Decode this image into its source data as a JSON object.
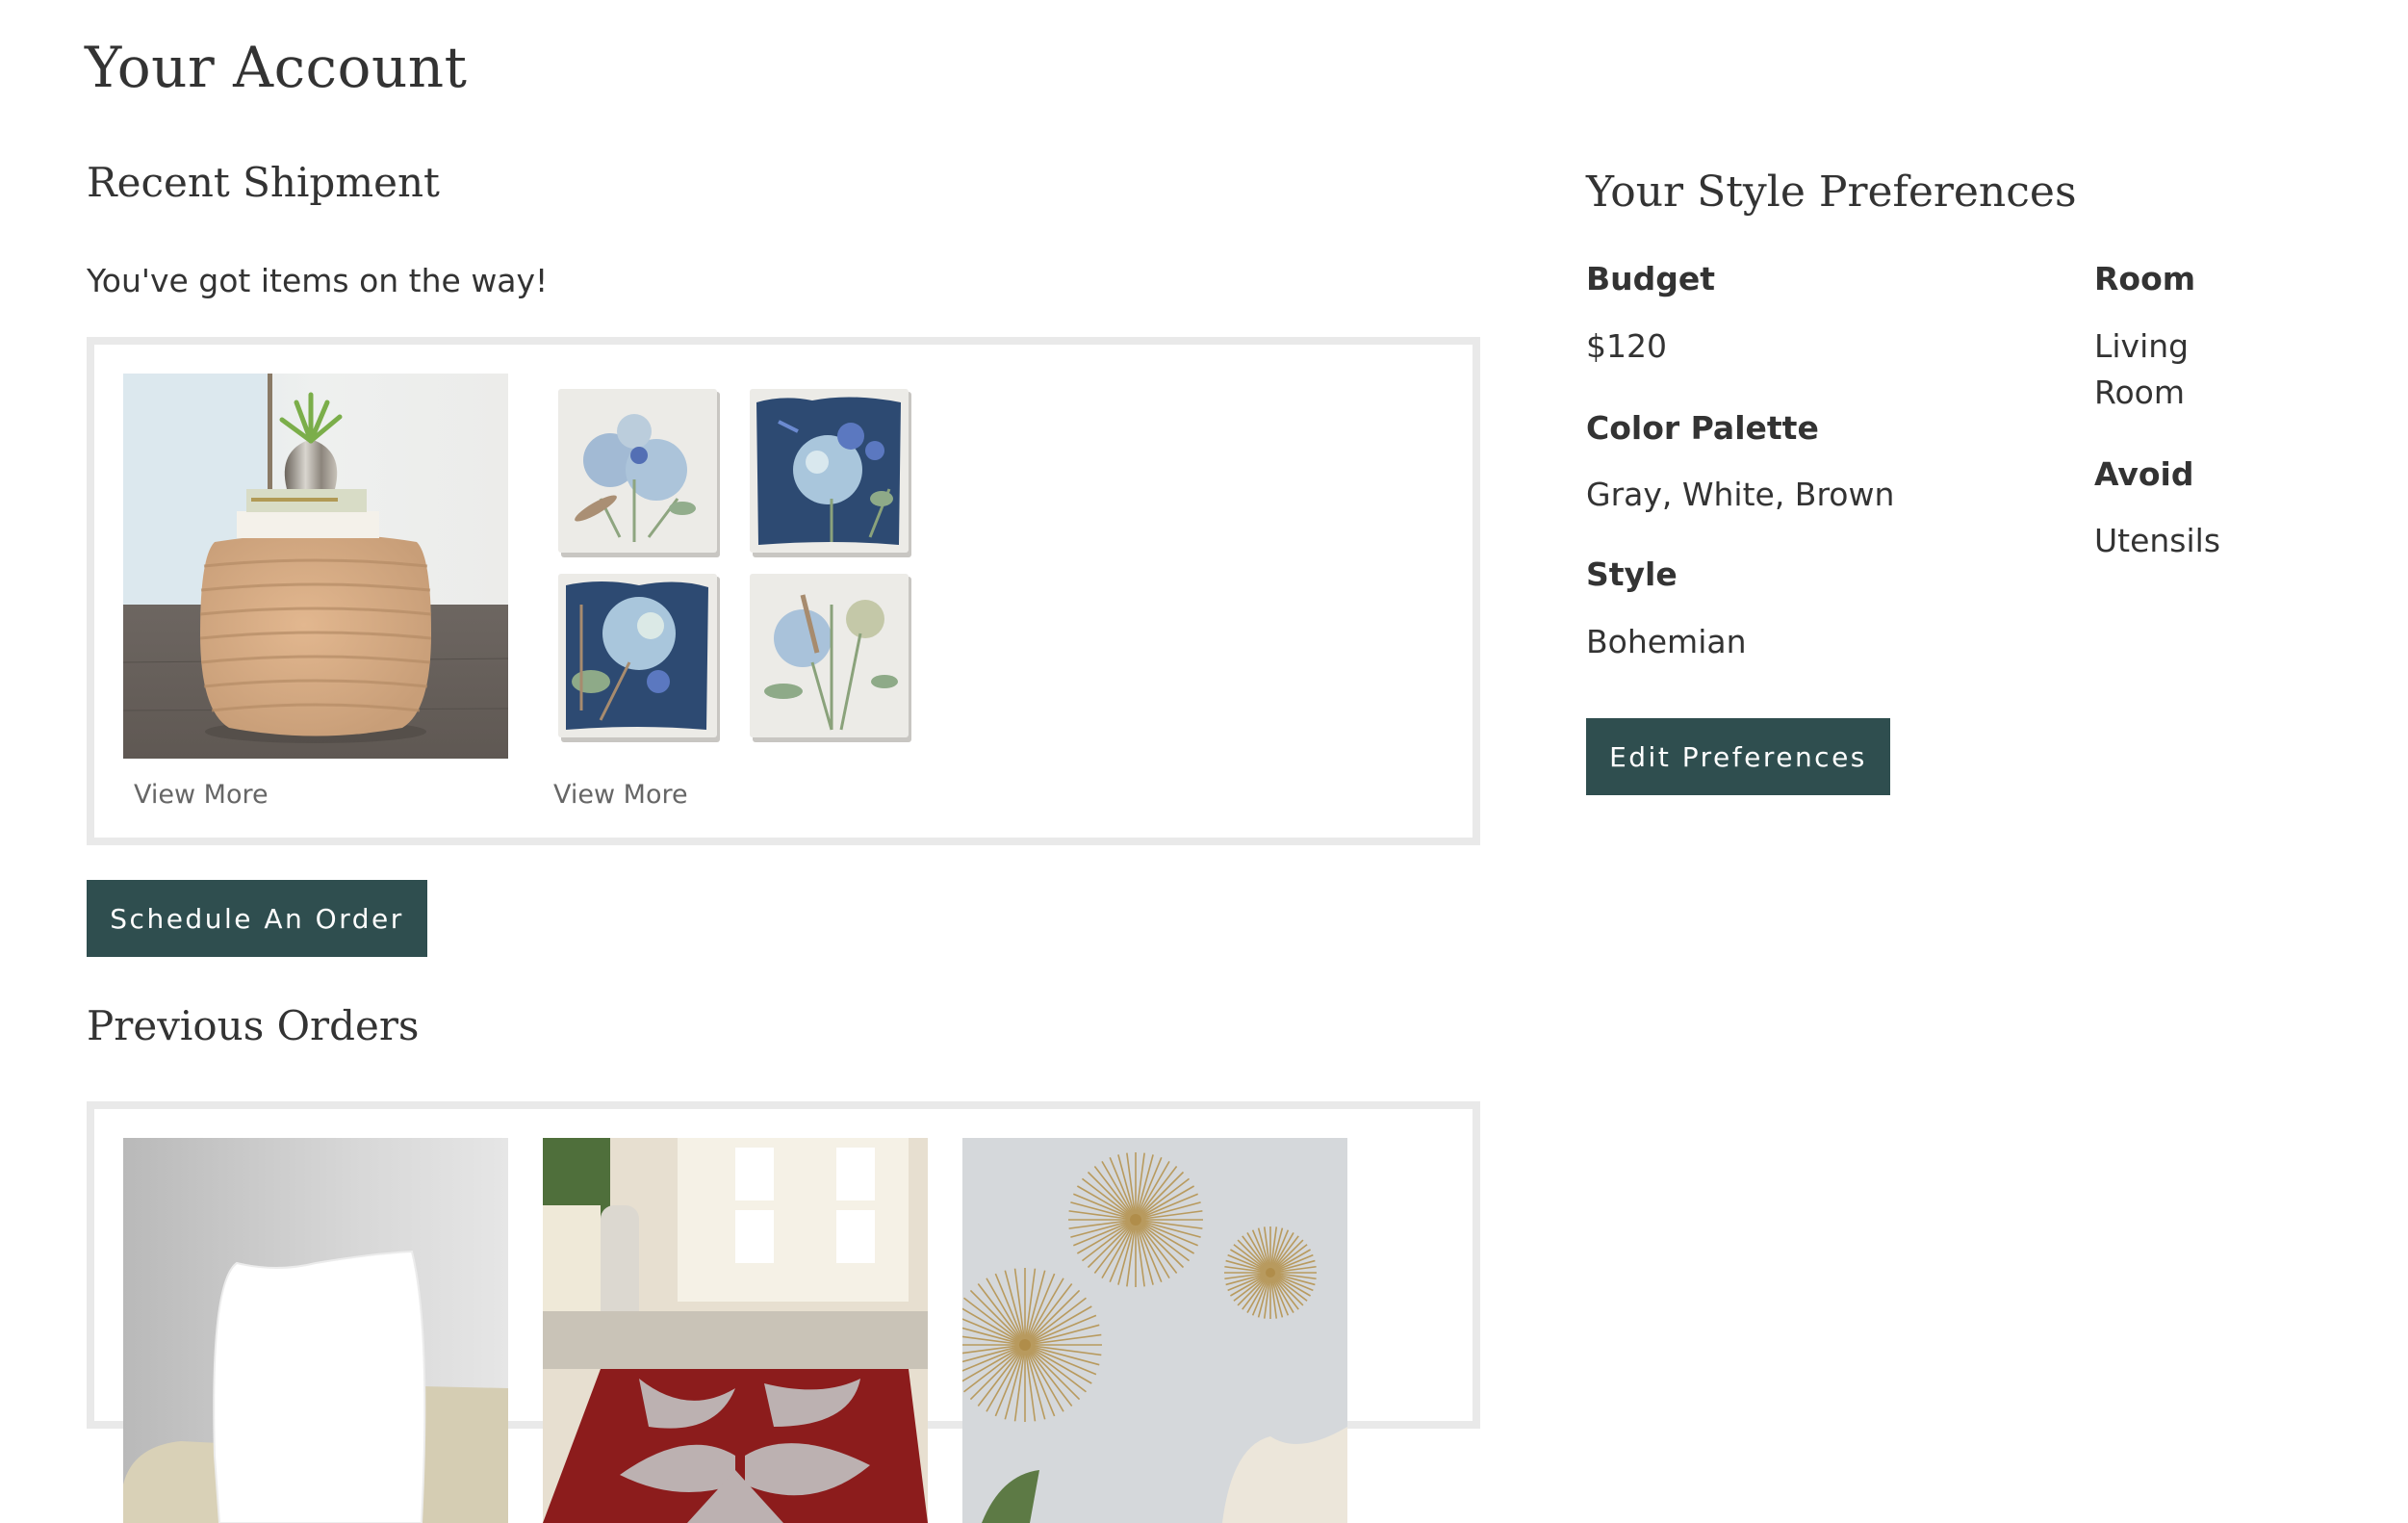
{
  "page": {
    "title": "Your Account"
  },
  "recent_shipment": {
    "heading": "Recent Shipment",
    "status": "You've got items on the way!",
    "items": [
      {
        "name": "Braided jute pouf",
        "image": "pouf-photo",
        "link_label": "View More"
      },
      {
        "name": "Blue hydrangea coaster set",
        "image": "floral-tiles-photo",
        "link_label": "View More"
      }
    ],
    "schedule_button": "Schedule An Order"
  },
  "previous_orders": {
    "heading": "Previous Orders",
    "items": [
      {
        "name": "White pillow insert",
        "image": "pillow-photo"
      },
      {
        "name": "Red and gray floral rug",
        "image": "rug-photo"
      },
      {
        "name": "Gold starburst wall decor",
        "image": "starburst-photo"
      }
    ]
  },
  "style_preferences": {
    "heading": "Your Style Preferences",
    "fields": {
      "budget": {
        "label": "Budget",
        "value": "$120"
      },
      "color_palette": {
        "label": "Color Palette",
        "value": "Gray, White, Brown"
      },
      "style": {
        "label": "Style",
        "value": "Bohemian"
      },
      "room": {
        "label": "Room",
        "value": "Living Room"
      },
      "avoid": {
        "label": "Avoid",
        "value": "Utensils"
      }
    },
    "edit_button": "Edit Preferences"
  },
  "colors": {
    "button_bg": "#2f4e4f",
    "button_text": "#ffffff",
    "box_border": "#e9e9e9",
    "text": "#333333",
    "link": "#666666"
  }
}
